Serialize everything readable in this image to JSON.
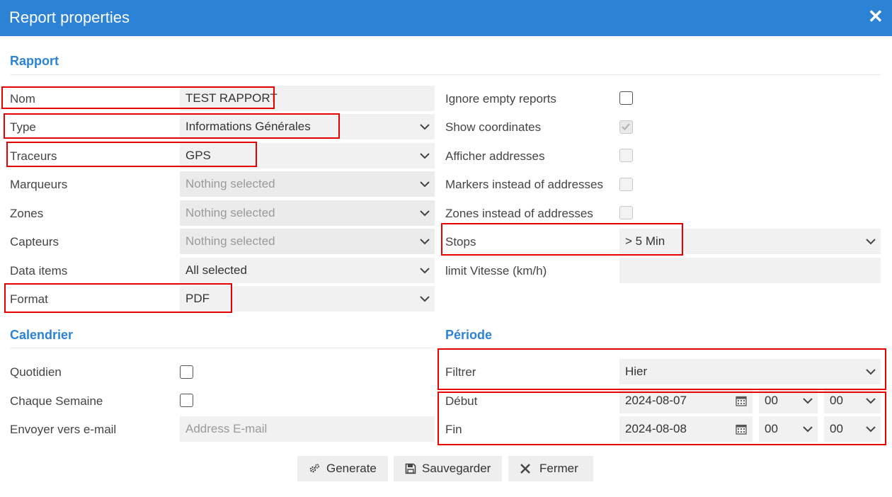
{
  "dialog": {
    "title": "Report properties",
    "close_glyph": "✕"
  },
  "sections": {
    "rapport": "Rapport",
    "calendrier": "Calendrier",
    "periode": "Période"
  },
  "left_fields": {
    "nom": {
      "label": "Nom",
      "value": "TEST RAPPORT"
    },
    "type": {
      "label": "Type",
      "value": "Informations Générales"
    },
    "traceurs": {
      "label": "Traceurs",
      "value": "GPS"
    },
    "marqueurs": {
      "label": "Marqueurs",
      "placeholder": "Nothing selected"
    },
    "zones": {
      "label": "Zones",
      "placeholder": "Nothing selected"
    },
    "capteurs": {
      "label": "Capteurs",
      "placeholder": "Nothing selected"
    },
    "data_items": {
      "label": "Data items",
      "value": "All selected"
    },
    "format": {
      "label": "Format",
      "value": "PDF"
    }
  },
  "right_fields": {
    "ignore_empty": {
      "label": "Ignore empty reports",
      "checked": false
    },
    "show_coords": {
      "label": "Show coordinates",
      "checked": true,
      "disabled": true
    },
    "afficher_addresses": {
      "label": "Afficher addresses",
      "checked": false,
      "disabled": true
    },
    "markers_instead": {
      "label": "Markers instead of addresses",
      "checked": false,
      "disabled": true
    },
    "zones_instead": {
      "label": "Zones instead of addresses",
      "checked": false,
      "disabled": true
    },
    "stops": {
      "label": "Stops",
      "value": "> 5 Min"
    },
    "limit_vitesse": {
      "label": "limit Vitesse (km/h)",
      "value": ""
    }
  },
  "calendrier": {
    "quotidien": {
      "label": "Quotidien",
      "checked": false
    },
    "chaque_semaine": {
      "label": "Chaque Semaine",
      "checked": false
    },
    "email": {
      "label": "Envoyer vers e-mail",
      "placeholder": "Address E-mail"
    }
  },
  "periode": {
    "filtrer": {
      "label": "Filtrer",
      "value": "Hier"
    },
    "debut": {
      "label": "Début",
      "date": "2024-08-07",
      "hour": "00",
      "minute": "00"
    },
    "fin": {
      "label": "Fin",
      "date": "2024-08-08",
      "hour": "00",
      "minute": "00"
    }
  },
  "buttons": {
    "generate": "Generate",
    "save": "Sauvegarder",
    "close": "Fermer"
  },
  "colors": {
    "accent": "#2c83d6",
    "highlight": "#e60000"
  }
}
